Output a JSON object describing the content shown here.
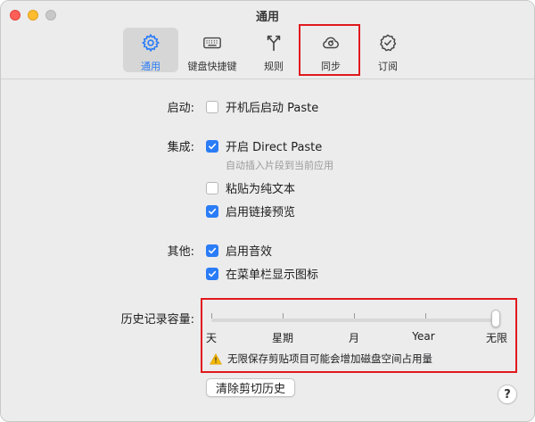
{
  "window": {
    "title": "通用"
  },
  "toolbar": {
    "items": [
      {
        "label": "通用",
        "icon": "gear-icon",
        "active": true
      },
      {
        "label": "键盘快捷键",
        "icon": "keyboard-icon",
        "active": false
      },
      {
        "label": "规则",
        "icon": "rules-icon",
        "active": false
      },
      {
        "label": "同步",
        "icon": "sync-cloud-icon",
        "active": false
      },
      {
        "label": "订阅",
        "icon": "subscription-badge-icon",
        "active": false
      }
    ]
  },
  "colors": {
    "accent": "#2a7cf7",
    "highlight": "#e0191e",
    "warning": "#f5b800"
  },
  "startup": {
    "label": "启动:",
    "options": [
      {
        "label": "开机后启动 Paste",
        "checked": false
      }
    ]
  },
  "integration": {
    "label": "集成:",
    "options": [
      {
        "label": "开启 Direct Paste",
        "checked": true
      },
      {
        "label": "粘贴为纯文本",
        "checked": false
      },
      {
        "label": "启用链接预览",
        "checked": true
      }
    ],
    "direct_paste_note": "自动插入片段到当前应用"
  },
  "other": {
    "label": "其他:",
    "options": [
      {
        "label": "启用音效",
        "checked": true
      },
      {
        "label": "在菜单栏显示图标",
        "checked": true
      }
    ]
  },
  "history": {
    "label": "历史记录容量:",
    "ticks": [
      "天",
      "星期",
      "月",
      "Year",
      "无限"
    ],
    "selected": "无限",
    "warning": "无限保存剪贴项目可能会增加磁盘空间占用量",
    "clear_button": "清除剪切历史"
  },
  "help": {
    "label": "?"
  }
}
